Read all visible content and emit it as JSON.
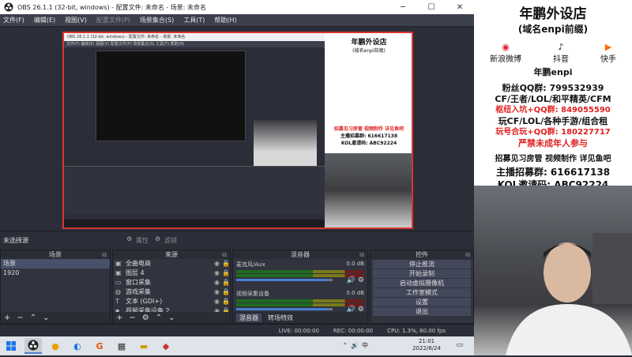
{
  "window": {
    "title": "OBS 26.1.1 (32-bit, windows) - 配置文件: 未命名 - 场景: 未命名"
  },
  "menu": [
    "文件(F)",
    "编辑(E)",
    "视图(V)",
    "配置文件(P)",
    "场景集合(S)",
    "工具(T)",
    "帮助(H)"
  ],
  "preview": {
    "capture_title": "OBS 26.1.1 (32-bit, windows) - 配置文件: 未命名 - 场景: 未命名",
    "capture_menu": "文件(F)  编辑(E)  视图(V)  配置文件(P)  场景集合(S)  工具(T)  帮助(H)"
  },
  "source_bar": {
    "no_source": "未选择源",
    "properties": "属性",
    "filters": "滤镜"
  },
  "docks": {
    "scenes": "场景",
    "sources": "来源",
    "mixer": "混音器",
    "controls": "控件"
  },
  "scenes": [
    "场景",
    "1920"
  ],
  "sources": [
    {
      "name": "全曲电商",
      "icon": "image-icon"
    },
    {
      "name": "图层 4",
      "icon": "image-icon"
    },
    {
      "name": "窗口采集",
      "icon": "window-icon"
    },
    {
      "name": "游戏采集",
      "icon": "gamepad-icon"
    },
    {
      "name": "文本 (GDI+)",
      "icon": "text-icon"
    },
    {
      "name": "视频采集设备 2",
      "icon": "camera-icon"
    }
  ],
  "mixer": [
    {
      "name": "麦克风/Aux",
      "db": "0.0 dB"
    },
    {
      "name": "视频采集设备",
      "db": "0.0 dB"
    }
  ],
  "mixer_tabs": [
    "混音器",
    "转场特效"
  ],
  "controls": [
    "停止推流",
    "开始录制",
    "启动虚拟摄像机",
    "工作室模式",
    "设置",
    "退出"
  ],
  "status": {
    "live": "LIVE: 00:00:00",
    "rec": "REC: 00:00:00",
    "cpu": "CPU: 1.3%, 60.00 fps"
  },
  "clock": {
    "time": "21:01",
    "date": "2022/8/24"
  },
  "sidebar": {
    "shop_title": "年鹏外设店",
    "shop_sub": "(域名enpi前缀)",
    "social": [
      "新浪微博",
      "抖音",
      "快手"
    ],
    "handle": "年鹏enpi",
    "lines": [
      {
        "text": "粉丝QQ群: 799532939",
        "color": "#111111"
      },
      {
        "text": "CF/王者/LOL/和平精英/CFM",
        "color": "#111111"
      },
      {
        "text": "枢纽入坑+QQ群: 849055590",
        "color": "#e02020"
      },
      {
        "text": "玩CF/LOL/各种手游/组合租",
        "color": "#111111"
      },
      {
        "text": "玩号合玩+QQ群: 180227717",
        "color": "#e02020"
      },
      {
        "text": "严禁未成年人参与",
        "color": "#e02020"
      }
    ],
    "recruit": "招募见习房管 视频制作 详见鱼吧",
    "anchor_group": "主播招募群: 616617138",
    "kol": "KOL邀请码: ABC92224"
  }
}
